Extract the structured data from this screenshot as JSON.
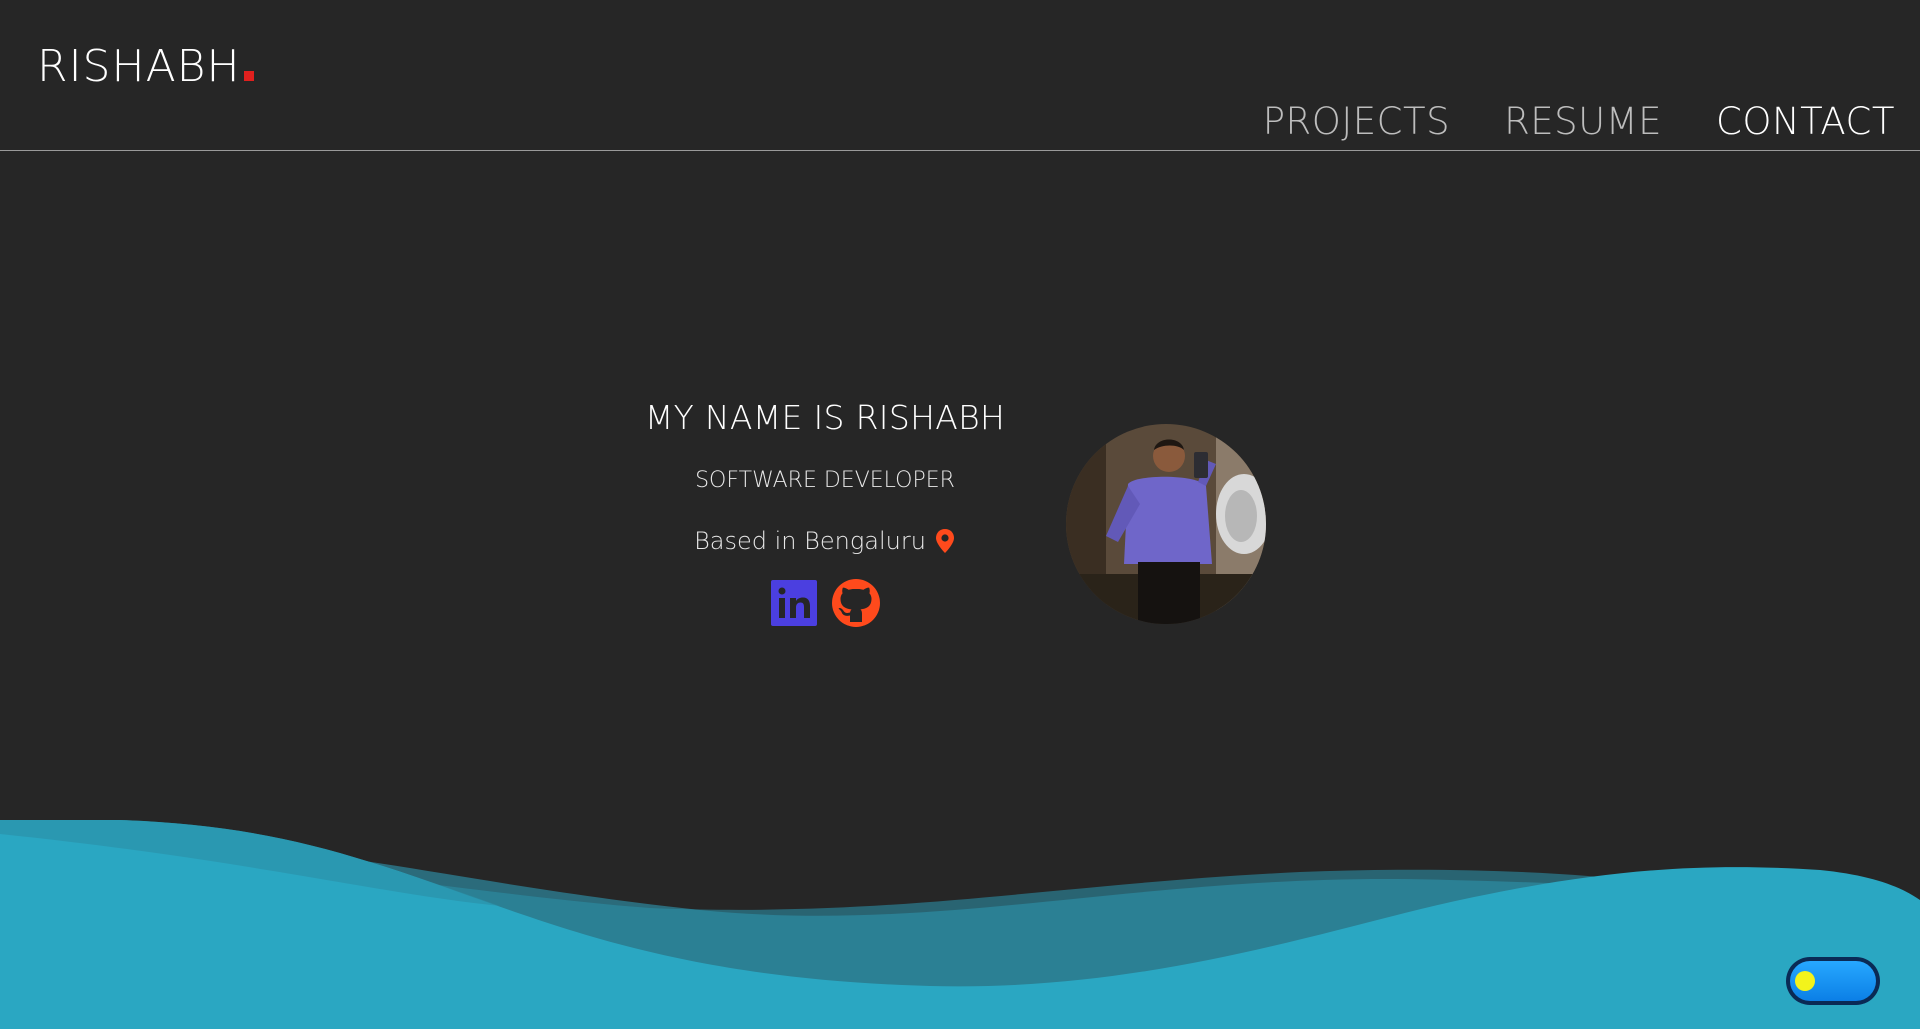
{
  "header": {
    "logo": "RISHABH",
    "nav": [
      {
        "label": "PROJECTS",
        "active": false
      },
      {
        "label": "RESUME",
        "active": false
      },
      {
        "label": "CONTACT",
        "active": true
      }
    ]
  },
  "hero": {
    "title": "MY NAME IS RISHABH",
    "role": "SOFTWARE DEVELOPER",
    "location": "Based in Bengaluru"
  },
  "icons": {
    "location": "map-pin-icon",
    "linkedin": "linkedin-icon",
    "github": "github-icon"
  },
  "colors": {
    "background": "#262626",
    "logo_dot": "#e0201e",
    "accent_orange": "#ff4a1c",
    "linkedin_blue": "#4b3fe0",
    "wave_front": "#2aa7c2",
    "wave_back": "#2b6f7f",
    "toggle_knob": "#f3f31b"
  },
  "theme_toggle": {
    "state": "dark"
  }
}
